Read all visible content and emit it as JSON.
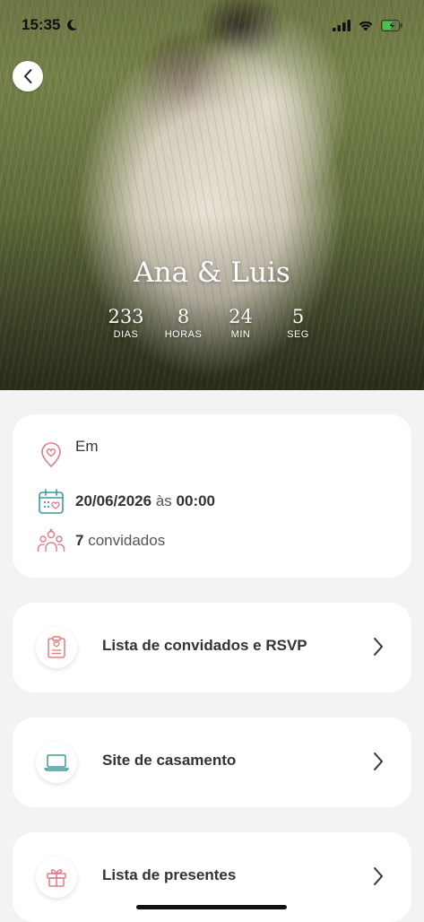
{
  "status_bar": {
    "time": "15:35"
  },
  "hero": {
    "couple_name": "Ana & Luis",
    "countdown": [
      {
        "value": "233",
        "label": "DIAS"
      },
      {
        "value": "8",
        "label": "HORAS"
      },
      {
        "value": "24",
        "label": "MIN"
      },
      {
        "value": "5",
        "label": "SEG"
      }
    ]
  },
  "info": {
    "location_label": "Em",
    "date": "20/06/2026",
    "date_connector": "às",
    "time": "00:00",
    "guests_count": "7",
    "guests_label": "convidados"
  },
  "menu": [
    {
      "label": "Lista de convidados e RSVP",
      "icon": "guest-list-icon"
    },
    {
      "label": "Site de casamento",
      "icon": "laptop-icon"
    },
    {
      "label": "Lista de presentes",
      "icon": "gift-icon"
    }
  ],
  "colors": {
    "accent_pink": "#e07b86",
    "accent_teal": "#3a9b9b",
    "background": "#f3f3f3"
  }
}
